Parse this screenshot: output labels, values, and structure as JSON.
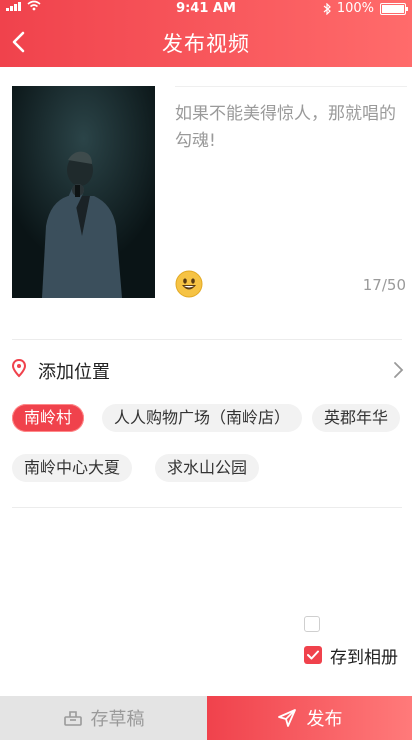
{
  "status_bar": {
    "time": "9:41 AM",
    "battery": "100%"
  },
  "header": {
    "title": "发布视频"
  },
  "post": {
    "caption_placeholder": "如果不能美得惊人，那就唱的勾魂!",
    "char_count": "17/50"
  },
  "location": {
    "label": "添加位置"
  },
  "tags": [
    "南岭村",
    "人人购物广场（南岭店）",
    "英郡年华",
    "南岭中心大夏",
    "求水山公园"
  ],
  "selected_tag": "南岭村",
  "options": {
    "save_to_album": "存到相册",
    "save_to_album_checked": true
  },
  "bottom_bar": {
    "draft_label": "存草稿",
    "publish_label": "发布"
  },
  "colors": {
    "accent": "#f0424c",
    "accent_light": "#ff6b6b"
  },
  "icons": {
    "back": "chevron-left-icon",
    "location": "map-pin-icon",
    "emoji": "smile-emoji-icon",
    "chevron": "chevron-right-icon",
    "draft": "draft-box-icon",
    "publish": "send-icon"
  }
}
